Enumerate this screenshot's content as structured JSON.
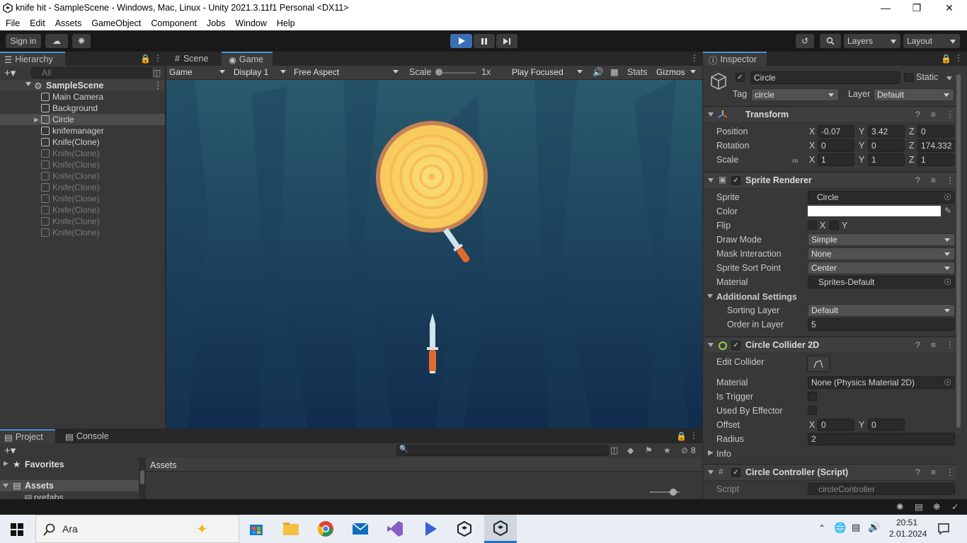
{
  "window": {
    "title": "knife hit - SampleScene - Windows, Mac, Linux - Unity 2021.3.11f1 Personal <DX11>"
  },
  "menu": [
    "File",
    "Edit",
    "Assets",
    "GameObject",
    "Component",
    "Jobs",
    "Window",
    "Help"
  ],
  "toolbar": {
    "sign_in": "Sign in",
    "layers": "Layers",
    "layout": "Layout"
  },
  "hierarchy": {
    "tab": "Hierarchy",
    "search_placeholder": "All",
    "scene": "SampleScene",
    "items": [
      {
        "label": "Main Camera",
        "dim": false
      },
      {
        "label": "Background",
        "dim": false
      },
      {
        "label": "Circle",
        "dim": false
      },
      {
        "label": "knifemanager",
        "dim": false
      },
      {
        "label": "Knife(Clone)",
        "dim": false
      },
      {
        "label": "Knife(Clone)",
        "dim": true
      },
      {
        "label": "Knife(Clone)",
        "dim": true
      },
      {
        "label": "Knife(Clone)",
        "dim": true
      },
      {
        "label": "Knife(Clone)",
        "dim": true
      },
      {
        "label": "Knife(Clone)",
        "dim": true
      },
      {
        "label": "Knife(Clone)",
        "dim": true
      },
      {
        "label": "Knife(Clone)",
        "dim": true
      },
      {
        "label": "Knife(Clone)",
        "dim": true
      }
    ]
  },
  "view": {
    "tab_scene": "Scene",
    "tab_game": "Game",
    "game_dropdown": "Game",
    "display": "Display 1",
    "aspect": "Free Aspect",
    "scale_label": "Scale",
    "scale_value": "1x",
    "play_focused": "Play Focused",
    "stats": "Stats",
    "gizmos": "Gizmos"
  },
  "project": {
    "tab_project": "Project",
    "tab_console": "Console",
    "favorites": "Favorites",
    "assets": "Assets",
    "prefabs": "prefabs",
    "assets_header": "Assets",
    "hidden_count": "8"
  },
  "inspector": {
    "tab": "Inspector",
    "object_name": "Circle",
    "static_label": "Static",
    "tag_label": "Tag",
    "tag_value": "circle",
    "layer_label": "Layer",
    "layer_value": "Default",
    "transform": {
      "title": "Transform",
      "position": "Position",
      "rotation": "Rotation",
      "scale": "Scale",
      "pos": {
        "x": "-0.07",
        "y": "3.42",
        "z": "0"
      },
      "rot": {
        "x": "0",
        "y": "0",
        "z": "174.332"
      },
      "scl": {
        "x": "1",
        "y": "1",
        "z": "1"
      }
    },
    "sprite_renderer": {
      "title": "Sprite Renderer",
      "sprite_label": "Sprite",
      "sprite": "Circle",
      "color_label": "Color",
      "flip_label": "Flip",
      "flip_x": "X",
      "flip_y": "Y",
      "draw_mode_label": "Draw Mode",
      "draw_mode": "Simple",
      "mask_label": "Mask Interaction",
      "mask": "None",
      "sort_point_label": "Sprite Sort Point",
      "sort_point": "Center",
      "material_label": "Material",
      "material": "Sprites-Default",
      "additional": "Additional Settings",
      "sorting_layer_label": "Sorting Layer",
      "sorting_layer": "Default",
      "order_label": "Order in Layer",
      "order": "5"
    },
    "circle_collider": {
      "title": "Circle Collider 2D",
      "edit_label": "Edit Collider",
      "material_label": "Material",
      "material": "None (Physics Material 2D)",
      "trigger_label": "Is Trigger",
      "effector_label": "Used By Effector",
      "offset_label": "Offset",
      "offset_x": "0",
      "offset_y": "0",
      "radius_label": "Radius",
      "radius": "2",
      "info": "Info"
    },
    "script": {
      "title": "Circle Controller (Script)",
      "script_label": "Script",
      "script": "circleController"
    }
  },
  "taskbar": {
    "search": "Ara",
    "time": "20:51",
    "date": "2.01.2024"
  },
  "colors": {
    "accent": "#4c8fdc",
    "game_bg_top": "#2a5a6e",
    "game_bg_bottom": "#0f2a4a",
    "log_yellow": "#f9d56a",
    "log_rim": "#c07a4a"
  }
}
